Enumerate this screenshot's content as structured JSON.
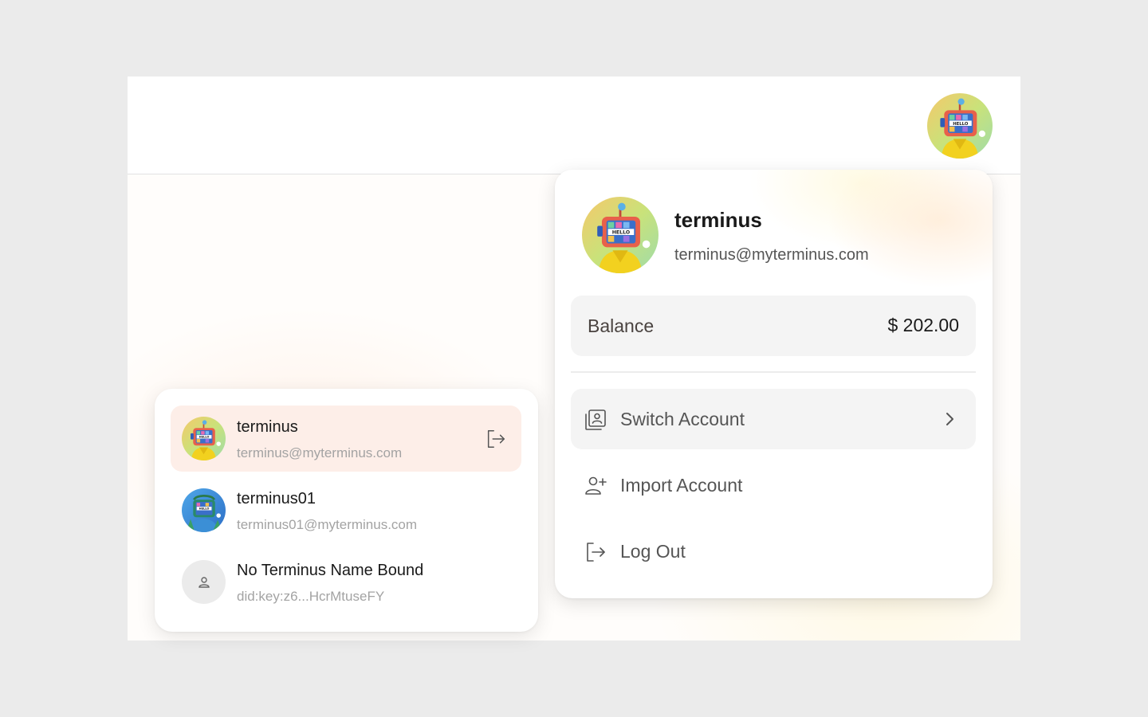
{
  "header": {
    "avatar_icon": "robot-hello-avatar"
  },
  "profile": {
    "name": "terminus",
    "email": "terminus@myterminus.com"
  },
  "balance": {
    "label": "Balance",
    "value": "$ 202.00"
  },
  "menu": {
    "items": [
      {
        "label": "Switch Account",
        "icon": "switch-account-icon"
      },
      {
        "label": "Import Account",
        "icon": "add-user-icon"
      },
      {
        "label": "Log Out",
        "icon": "logout-icon"
      }
    ]
  },
  "accounts": [
    {
      "name": "terminus",
      "sub": "terminus@myterminus.com",
      "current": true
    },
    {
      "name": "terminus01",
      "sub": "terminus01@myterminus.com",
      "current": false
    },
    {
      "name": "No Terminus Name Bound",
      "sub": "did:key:z6...HcrMtuseFY",
      "current": false
    }
  ],
  "colors": {
    "active_row": "#fdeee8",
    "card_bg": "#f4f4f4",
    "page_bg": "#ebebeb"
  }
}
